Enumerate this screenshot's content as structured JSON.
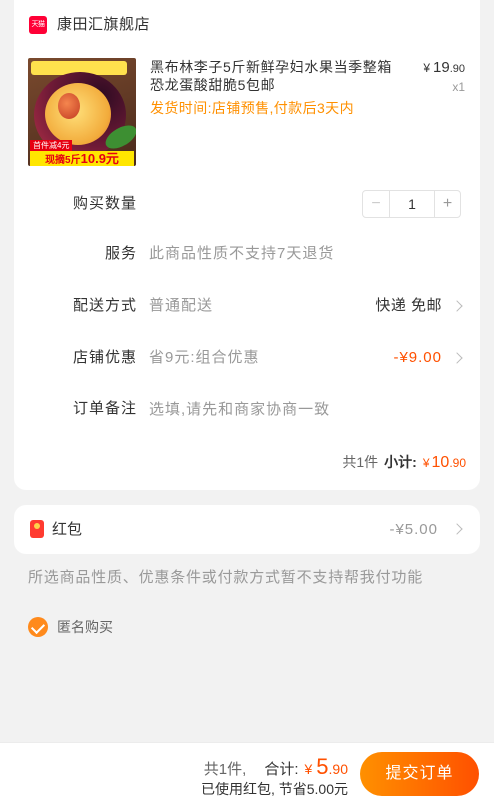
{
  "store": {
    "badge": "天猫",
    "name": "康田汇旗舰店"
  },
  "product": {
    "title": "黑布林李子5斤新鲜孕妇水果当季整箱恐龙蛋酸甜脆5包邮",
    "price": {
      "symbol": "¥",
      "integer": "19",
      "decimal": ".90"
    },
    "quantity": "x1",
    "ship_time": "发货时间:店铺预售,付款后3天内",
    "image": {
      "badge": "首件减4元",
      "promo_prefix": "现摘5斤",
      "promo_price": "10.9元"
    }
  },
  "quantity": {
    "label": "购买数量",
    "minus": "−",
    "value": "1",
    "plus": "+"
  },
  "service": {
    "label": "服务",
    "value": "此商品性质不支持7天退货"
  },
  "delivery": {
    "label": "配送方式",
    "value": "普通配送",
    "option": "快递 免邮"
  },
  "shop_discount": {
    "label": "店铺优惠",
    "value": "省9元:组合优惠",
    "amount": "-¥9.00"
  },
  "note": {
    "label": "订单备注",
    "placeholder": "选填,请先和商家协商一致"
  },
  "subtotal": {
    "count": "共1件",
    "label": "小计:",
    "symbol": "¥",
    "integer": "10",
    "decimal": ".90"
  },
  "red_packet": {
    "label": "红包",
    "amount": "-¥5.00"
  },
  "notice": "所选商品性质、优惠条件或付款方式暂不支持帮我付功能",
  "anonymous": {
    "label": "匿名购买",
    "checked": true
  },
  "footer": {
    "count": "共1件,",
    "total_label": "合计:",
    "total": {
      "symbol": "¥",
      "integer": "5",
      "decimal": ".90"
    },
    "saving": "已使用红包, 节省5.00元",
    "submit": "提交订单"
  },
  "colors": {
    "accent": "#ff5000",
    "ship_time": "#ff9000",
    "tmall": "#ff0036",
    "button_from": "#ff9000",
    "button_to": "#ff5000",
    "red_packet": "#ff3b30"
  },
  "icons": {
    "store": "tmall-logo-icon",
    "red_packet": "red-packet-icon",
    "anonymous": "check-circle-icon",
    "row_arrow": "chevron-right-icon"
  }
}
